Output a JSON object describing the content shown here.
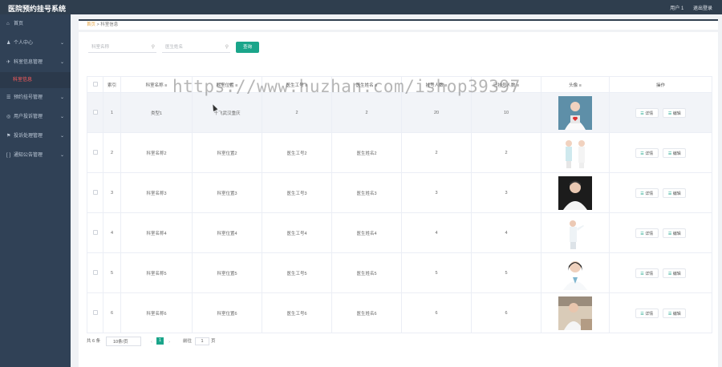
{
  "app": {
    "title": "医院预约挂号系统",
    "user": "用户 1",
    "logout": "退出登录"
  },
  "sidebar": {
    "items": [
      {
        "label": "首页",
        "icon": "home-icon",
        "glyph": "⌂",
        "chevron": ""
      },
      {
        "label": "个人中心",
        "icon": "user-icon",
        "glyph": "♟",
        "chevron": "⌄"
      },
      {
        "label": "科室信息管理",
        "icon": "send-icon",
        "glyph": "✈",
        "chevron": "⌄"
      },
      {
        "label": "预约挂号管理",
        "icon": "list-icon",
        "glyph": "☰",
        "chevron": "⌄"
      },
      {
        "label": "用户投诉管理",
        "icon": "help-icon",
        "glyph": "◎",
        "chevron": "⌄"
      },
      {
        "label": "投诉处理管理",
        "icon": "flag-icon",
        "glyph": "⚑",
        "chevron": "⌄"
      },
      {
        "label": "通知公告管理",
        "icon": "bracket-icon",
        "glyph": "[ ]",
        "chevron": "⌄"
      }
    ],
    "active_sub": "科室信息"
  },
  "breadcrumb": {
    "home": "首页",
    "sep": ">",
    "current": "科室信息"
  },
  "search": {
    "placeholder1": "科室名称",
    "placeholder2": "医生姓名",
    "button": "查询"
  },
  "table": {
    "headers": [
      "索引",
      "科室名称 ≡",
      "科室位置 ≡",
      "医生工号 ≡",
      "医生姓名 ≡",
      "挂号人数 ≡",
      "已挂号人数 ≡",
      "头像 ≡",
      "操作"
    ],
    "rows": [
      {
        "idx": "1",
        "name": "类型1",
        "loc": "千飞武汉重庆",
        "docno": "2",
        "doc": "2",
        "quota": "20",
        "booked": "10"
      },
      {
        "idx": "2",
        "name": "科室名称2",
        "loc": "科室位置2",
        "docno": "医生工号2",
        "doc": "医生姓名2",
        "quota": "2",
        "booked": "2"
      },
      {
        "idx": "3",
        "name": "科室名称3",
        "loc": "科室位置3",
        "docno": "医生工号3",
        "doc": "医生姓名3",
        "quota": "3",
        "booked": "3"
      },
      {
        "idx": "4",
        "name": "科室名称4",
        "loc": "科室位置4",
        "docno": "医生工号4",
        "doc": "医生姓名4",
        "quota": "4",
        "booked": "4"
      },
      {
        "idx": "5",
        "name": "科室名称5",
        "loc": "科室位置5",
        "docno": "医生工号5",
        "doc": "医生姓名5",
        "quota": "5",
        "booked": "5"
      },
      {
        "idx": "6",
        "name": "科室名称6",
        "loc": "科室位置6",
        "docno": "医生工号6",
        "doc": "医生姓名6",
        "quota": "6",
        "booked": "6"
      }
    ],
    "detail_label": "详情",
    "edit_label": "编辑"
  },
  "pager": {
    "total": "共 6 条",
    "size": "10条/页",
    "current": "1",
    "goto": "前往",
    "page_value": "1",
    "page_unit": "页",
    "prev": "‹",
    "next": "›"
  },
  "watermark": "https://www.huzhan.com/ishop39397",
  "colors": {
    "accent": "#1aa58a",
    "sidebar": "#304156",
    "topbar": "#2f3e4e",
    "active_sub": "#ff5c5c"
  }
}
